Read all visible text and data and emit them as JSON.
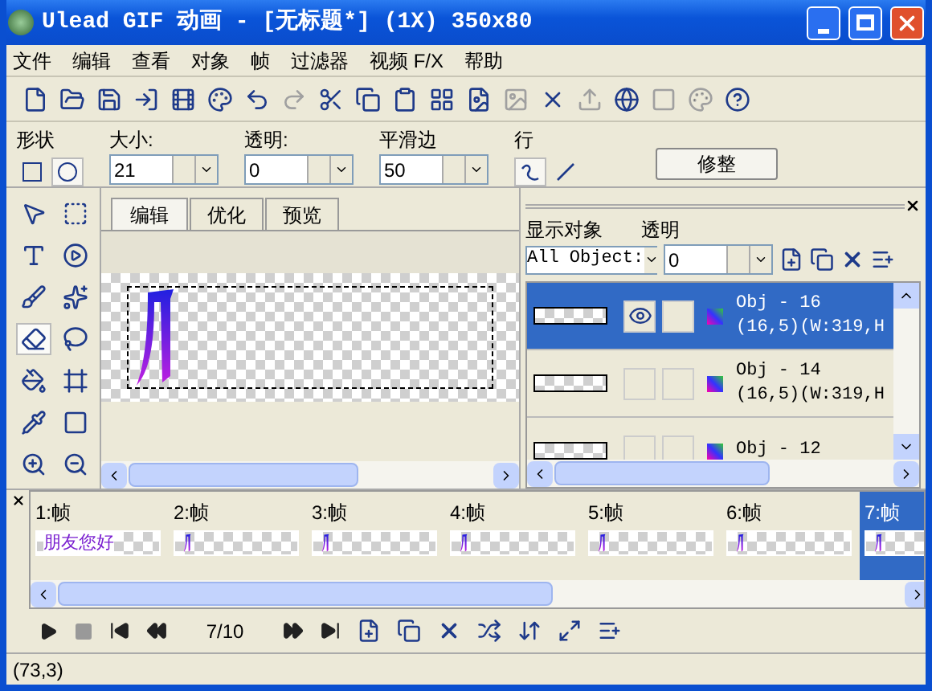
{
  "window": {
    "title": "Ulead GIF 动画 - [无标题*] (1X) 350x80"
  },
  "menu": [
    "文件",
    "编辑",
    "查看",
    "对象",
    "帧",
    "过滤器",
    "视频 F/X",
    "帮助"
  ],
  "toolbar": [
    {
      "disabled": false
    },
    {
      "disabled": false
    },
    {
      "disabled": false
    },
    {
      "disabled": false
    },
    {
      "disabled": false
    },
    {
      "disabled": false
    },
    {
      "disabled": false
    },
    {
      "disabled": true
    },
    {
      "disabled": false
    },
    {
      "disabled": false
    },
    {
      "disabled": false
    },
    {
      "disabled": false
    },
    {
      "disabled": false
    },
    {
      "disabled": true
    },
    {
      "disabled": false
    },
    {
      "disabled": true
    },
    {
      "disabled": false
    },
    {
      "disabled": true
    },
    {
      "disabled": true
    },
    {
      "disabled": false
    }
  ],
  "attributes": {
    "shape": {
      "label": "形状",
      "options": [
        {
          "selected": false
        },
        {
          "selected": true
        }
      ]
    },
    "fields": [
      {
        "label": "大小:",
        "value": "21"
      },
      {
        "label": "透明:",
        "value": "0"
      },
      {
        "label": "平滑边",
        "value": "50"
      }
    ],
    "line": {
      "label": "行",
      "options": [
        {
          "selected": true
        },
        {
          "selected": false
        }
      ]
    },
    "button": "修整"
  },
  "tools": [
    {
      "selected": false
    },
    {
      "selected": false
    },
    {
      "selected": false
    },
    {
      "selected": false
    },
    {
      "selected": false
    },
    {
      "selected": false
    },
    {
      "selected": true
    },
    {
      "selected": false
    },
    {
      "selected": false
    },
    {
      "selected": false
    },
    {
      "selected": false
    },
    {
      "selected": false
    },
    {
      "selected": false
    },
    {
      "selected": false
    }
  ],
  "tabs": [
    {
      "label": "编辑",
      "selected": true
    },
    {
      "label": "优化",
      "selected": false
    },
    {
      "label": "预览",
      "selected": false
    }
  ],
  "objects_panel": {
    "show_label": "显示对象",
    "show_value": "All Object:",
    "opacity_label": "透明",
    "opacity_value": "0",
    "objects": [
      {
        "name": "Obj - 16",
        "position": "(16,5)(W:319,H",
        "selected": true,
        "visible": true
      },
      {
        "name": "Obj - 14",
        "position": "(16,5)(W:319,H",
        "selected": false,
        "visible": false
      },
      {
        "name": "Obj - 12",
        "selected": false,
        "visible": false
      }
    ]
  },
  "frames": [
    {
      "label": "1:帧",
      "thumbnail_text": "朋友您好",
      "selected": false
    },
    {
      "label": "2:帧",
      "selected": false
    },
    {
      "label": "3:帧",
      "selected": false
    },
    {
      "label": "4:帧",
      "selected": false
    },
    {
      "label": "5:帧",
      "selected": false
    },
    {
      "label": "6:帧",
      "selected": false
    },
    {
      "label": "7:帧",
      "selected": true
    }
  ],
  "playback": {
    "counter": "7/10"
  },
  "status_bar": {
    "coords": "(73,3)"
  }
}
